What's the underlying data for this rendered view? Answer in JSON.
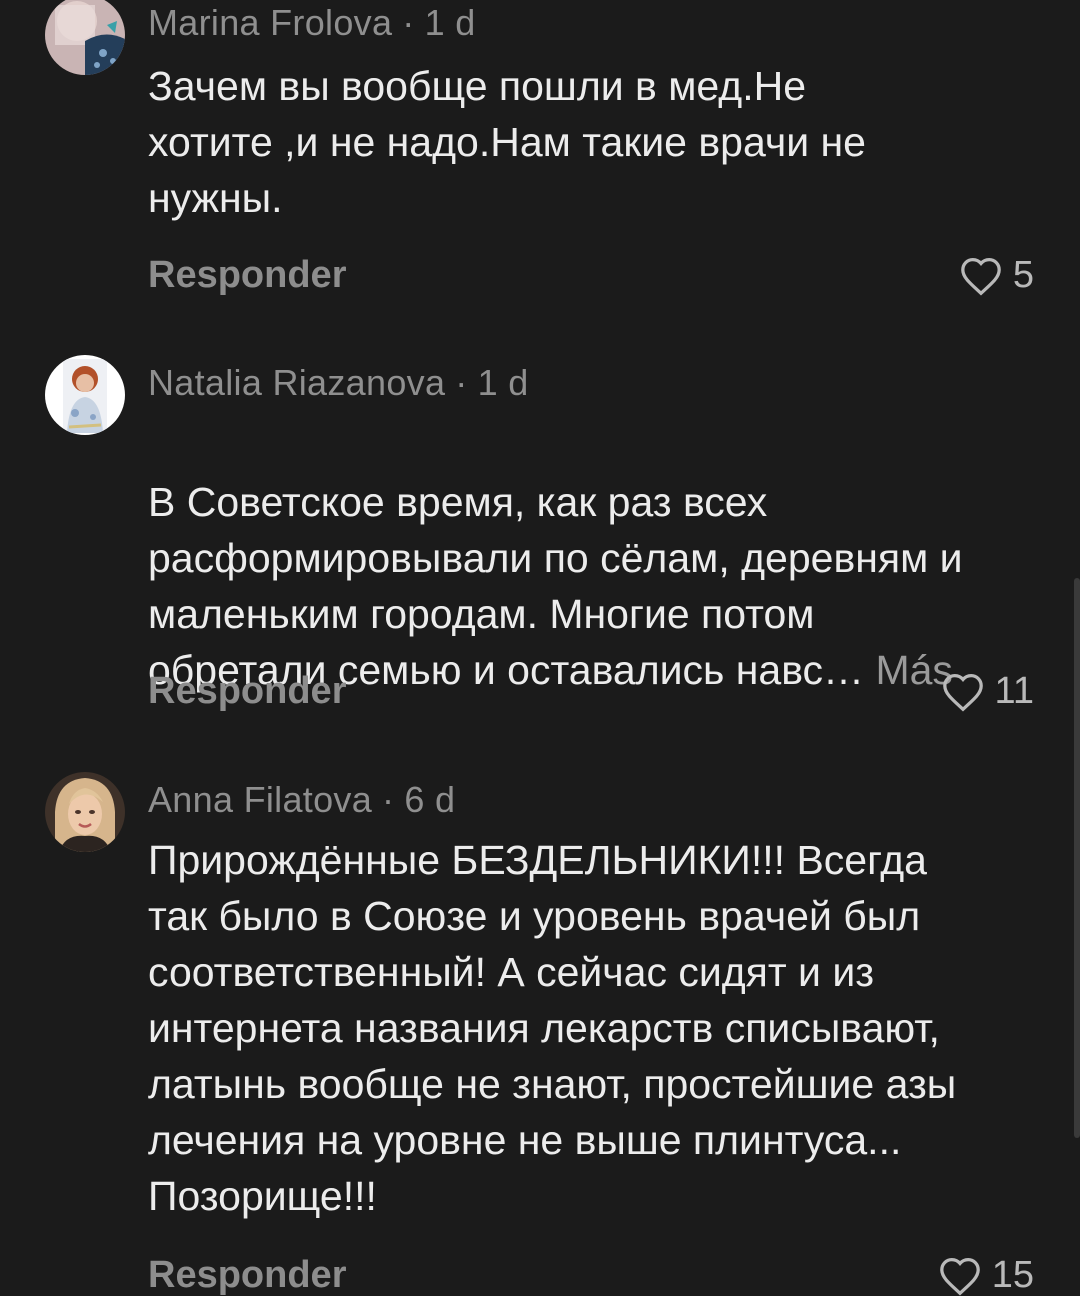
{
  "comments": [
    {
      "author": "Marina Frolova",
      "age": "1 d",
      "text": "Зачем вы вообще пошли в мед.Не\nхотите ,и не надо.Нам такие врачи не\nнужны.",
      "more": "",
      "reply_label": "Responder",
      "likes": "5",
      "avatar_colors": [
        "#d8c4c2",
        "#2f4b67"
      ]
    },
    {
      "author": "Natalia Riazanova",
      "age": "1 d",
      "text": "В Советское время, как раз всех\nрасформировывали по сёлам, деревням и\nмаленьким городам. Многие потом\nобретали семью и оставались навс…",
      "more": "Más",
      "reply_label": "Responder",
      "likes": "11",
      "avatar_colors": [
        "#ffffff",
        "#b85a2e"
      ]
    },
    {
      "author": "Anna Filatova",
      "age": "6 d",
      "text": "Прирождённые БЕЗДЕЛЬНИКИ!!! Всегда\nтак было в Союзе и уровень врачей был\nсоответственный! А сейчас сидят и из\nинтернета названия лекарств списывают,\nлатынь вообще не знают, простейшие азы\nлечения на уровне не выше плинтуса...\nПозорище!!!",
      "more": "",
      "reply_label": "Responder",
      "likes": "15",
      "avatar_colors": [
        "#4a3a30",
        "#e2c19e"
      ]
    }
  ],
  "separator": "·",
  "colors": {
    "background": "#1b1b1b",
    "text": "#ececec",
    "muted": "#8f8f8f"
  }
}
